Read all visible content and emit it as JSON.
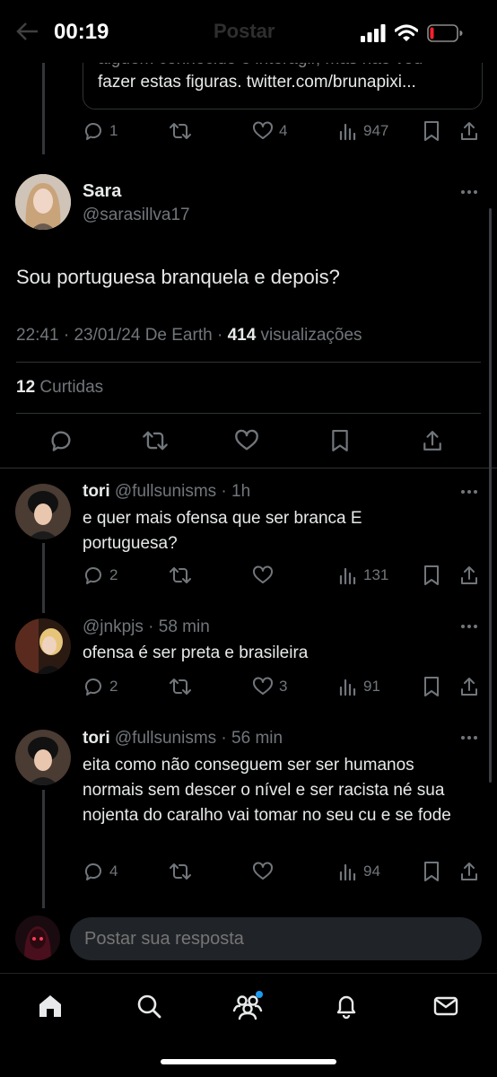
{
  "status_bar": {
    "time": "00:19",
    "ghost_title": "Postar"
  },
  "quoted_tweet": {
    "line1": "alguém conhecido e interagir, mas não vou",
    "line2": "fazer estas figuras. twitter.com/brunapixi..."
  },
  "top_actions": {
    "replies": "1",
    "retweets": "",
    "likes": "4",
    "views": "947"
  },
  "main_tweet": {
    "name": "Sara",
    "handle": "@sarasillva17",
    "text": "Sou portuguesa branquela e depois?",
    "time": "22:41",
    "date": "23/01/24",
    "source": "De Earth",
    "views_count": "414",
    "views_label": "visualizações",
    "likes_count": "12",
    "likes_label": "Curtidas"
  },
  "replies": [
    {
      "name": "tori",
      "handle": "@fullsunisms",
      "time": "1h",
      "text": "e quer mais ofensa que ser branca E portuguesa?",
      "replies": "2",
      "retweets": "",
      "likes": "",
      "views": "131"
    },
    {
      "name": "",
      "handle": "@jnkpjs",
      "time": "58 min",
      "text": "ofensa é ser preta e brasileira",
      "replies": "2",
      "retweets": "",
      "likes": "3",
      "views": "91"
    },
    {
      "name": "tori",
      "handle": "@fullsunisms",
      "time": "56 min",
      "text": "eita como não conseguem ser ser humanos normais sem descer o nível e ser racista né sua nojenta do caralho vai tomar no seu cu e se fode",
      "replies": "4",
      "retweets": "",
      "likes": "",
      "views": "94"
    }
  ],
  "composer": {
    "placeholder": "Postar sua resposta"
  },
  "bottom_nav": [
    "home-icon",
    "search-icon",
    "communities-icon",
    "notifications-icon",
    "messages-icon"
  ],
  "colors": {
    "background": "#000000",
    "text": "#e7e9ea",
    "muted": "#71767b",
    "divider": "#2f3336",
    "accent": "#1d9bf0",
    "battery": "#f4212e"
  }
}
